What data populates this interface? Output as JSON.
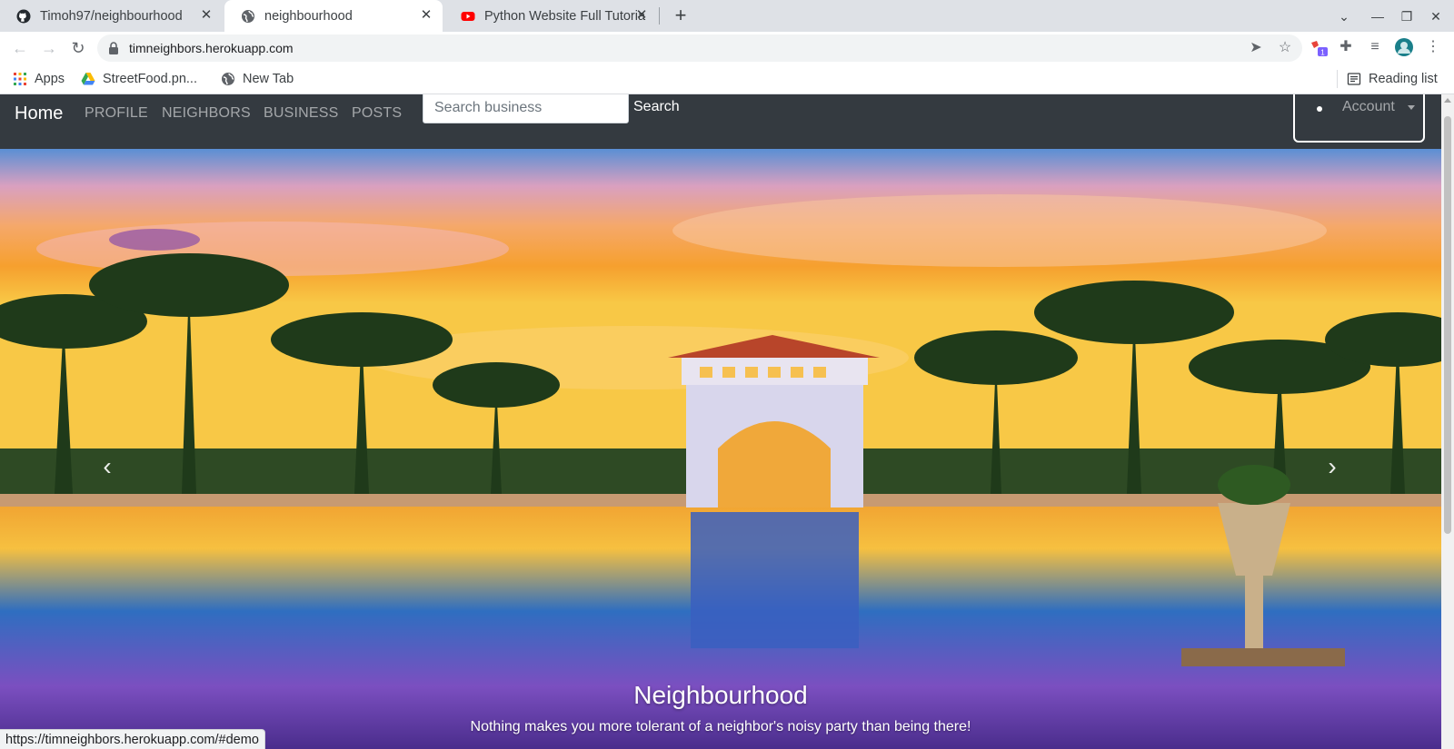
{
  "browser": {
    "tabs": [
      {
        "title": "Timoh97/neighbourhood",
        "icon": "github-icon",
        "active": false
      },
      {
        "title": "neighbourhood",
        "icon": "globe-icon",
        "active": true
      },
      {
        "title": "Python Website Full Tutorial",
        "icon": "youtube-icon",
        "active": false
      }
    ],
    "url": "timneighbors.herokuapp.com",
    "bookmarks": [
      {
        "label": "Apps",
        "icon": "apps-grid-icon"
      },
      {
        "label": "StreetFood.pn...",
        "icon": "google-drive-icon"
      },
      {
        "label": "New Tab",
        "icon": "globe-icon"
      }
    ],
    "reading_list": "Reading list",
    "extension_badge": "1",
    "status_url": "https://timneighbors.herokuapp.com/#demo"
  },
  "navbar": {
    "brand": "Home",
    "links": [
      "PROFILE",
      "NEIGHBORS",
      "BUSINESS",
      "POSTS"
    ],
    "search_placeholder": "Search business",
    "search_button": "Search",
    "account": "Account"
  },
  "hero": {
    "title": "Neighbourhood",
    "subtitle": "Nothing makes you more tolerant of a neighbor's noisy party than being there!"
  },
  "colors": {
    "navbar_bg": "#343a40",
    "tabstrip_bg": "#dee1e6"
  }
}
